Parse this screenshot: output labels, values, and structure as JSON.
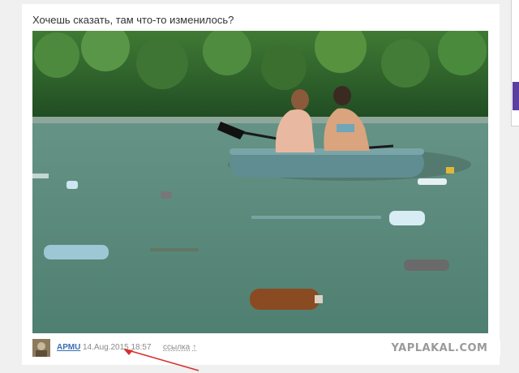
{
  "post": {
    "question": "Хочешь сказать, там что-то изменилось?"
  },
  "meta": {
    "author": "АРМU",
    "date": "14.Aug.2015 18:57",
    "link_label": "ссылка",
    "link_arrow": "↑"
  },
  "watermark": "YAPLAKAL.COM",
  "colors": {
    "author_link": "#3b6fb0",
    "side_accent": "#5b3fa0",
    "annotation_arrow": "#d9302c"
  },
  "icons": {
    "link": "up-arrow-icon",
    "annotation": "red-arrow-icon"
  }
}
